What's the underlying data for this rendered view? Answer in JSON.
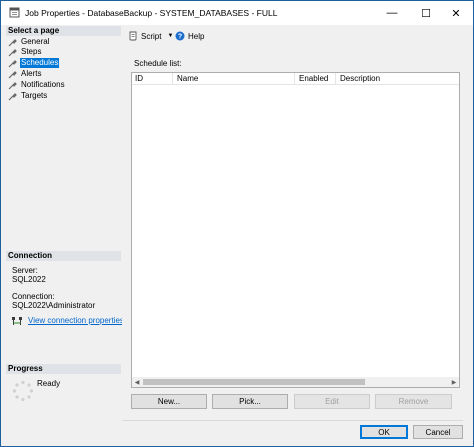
{
  "window": {
    "title": "Job Properties - DatabaseBackup - SYSTEM_DATABASES - FULL",
    "min_glyph": "—",
    "max_glyph": "☐",
    "close_glyph": "✕"
  },
  "left": {
    "select_page_heading": "Select a page",
    "pages": [
      {
        "label": "General"
      },
      {
        "label": "Steps"
      },
      {
        "label": "Schedules",
        "selected": true
      },
      {
        "label": "Alerts"
      },
      {
        "label": "Notifications"
      },
      {
        "label": "Targets"
      }
    ],
    "connection_heading": "Connection",
    "server_label": "Server:",
    "server_value": "SQL2022",
    "connection_label": "Connection:",
    "connection_value": "SQL2022\\Administrator",
    "view_connection_link": "View connection properties",
    "progress_heading": "Progress",
    "progress_status": "Ready"
  },
  "toolbar": {
    "script_label": "Script",
    "help_label": "Help"
  },
  "schedules": {
    "list_label": "Schedule list:",
    "columns": [
      "ID",
      "Name",
      "Enabled",
      "Description"
    ],
    "rows": []
  },
  "buttons": {
    "new": "New...",
    "pick": "Pick...",
    "edit": "Edit",
    "remove": "Remove",
    "ok": "OK",
    "cancel": "Cancel"
  },
  "icons": {
    "page_icon": "wrench-icon",
    "script_icon": "script-icon",
    "help_icon": "help-icon",
    "connection_icon": "connection-icon",
    "progress_icon": "spinner-icon"
  },
  "colors": {
    "selection": "#0078d7",
    "link": "#0066cc",
    "section_header": "#dfe3e8"
  }
}
